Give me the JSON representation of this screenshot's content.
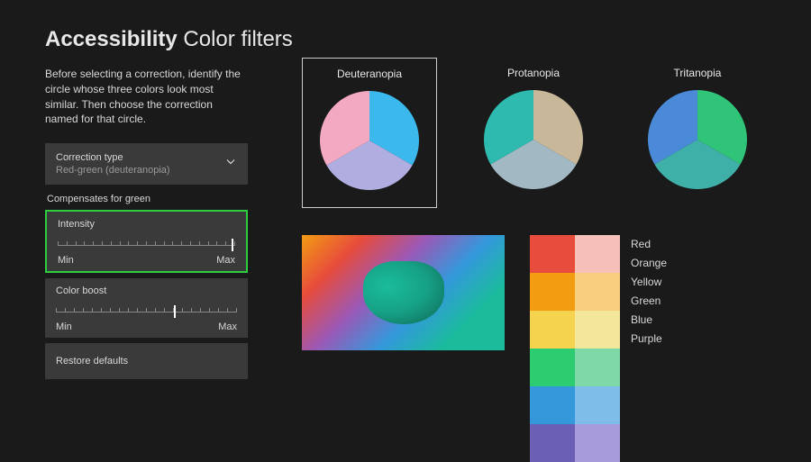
{
  "title": {
    "bold": "Accessibility",
    "light": "Color filters"
  },
  "description": "Before selecting a correction, identify the circle whose three colors look most similar. Then choose the correction named for that circle.",
  "correction": {
    "label": "Correction type",
    "value": "Red-green (deuteranopia)"
  },
  "compensates": "Compensates for green",
  "intensity": {
    "label": "Intensity",
    "min": "Min",
    "max": "Max",
    "value_pct": 98
  },
  "colorboost": {
    "label": "Color boost",
    "min": "Min",
    "max": "Max",
    "value_pct": 65
  },
  "restore": "Restore defaults",
  "circles": [
    {
      "label": "Deuteranopia",
      "selected": true,
      "colors": [
        "#3bb8ec",
        "#b0aee0",
        "#f3a9c1"
      ]
    },
    {
      "label": "Protanopia",
      "selected": false,
      "colors": [
        "#c9b79a",
        "#a2b9c4",
        "#2fbab0"
      ]
    },
    {
      "label": "Tritanopia",
      "selected": false,
      "colors": [
        "#2fc478",
        "#3fb0a8",
        "#4a8ad8"
      ]
    }
  ],
  "swatches": [
    {
      "label": "Red",
      "left": "#e74c3c",
      "right": "#f4c0b8"
    },
    {
      "label": "Orange",
      "left": "#f39c12",
      "right": "#f7cf7f"
    },
    {
      "label": "Yellow",
      "left": "#f6d34e",
      "right": "#f2e79b"
    },
    {
      "label": "Green",
      "left": "#2ecc71",
      "right": "#7fd8a8"
    },
    {
      "label": "Blue",
      "left": "#3498db",
      "right": "#7ebdea"
    },
    {
      "label": "Purple",
      "left": "#6b5fb5",
      "right": "#a79bdc"
    }
  ]
}
